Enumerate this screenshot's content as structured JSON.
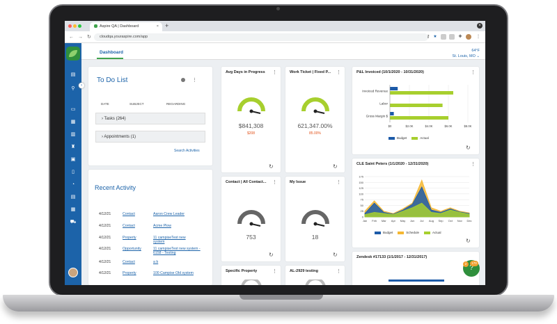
{
  "browser": {
    "tab_title": "Aspire QA | Dashboard",
    "url": "cloudqa.youraspire.com/app",
    "new_tab": "+",
    "close": "×"
  },
  "nav": {
    "dashboard_tab": "Dashboard",
    "weather_temp": "64°F",
    "weather_location": "St. Louis, MO"
  },
  "todo": {
    "title": "To Do List",
    "headers": [
      "DATE",
      "SUBJECT",
      "REGARDING"
    ],
    "tasks": "Tasks (264)",
    "appointments": "Appointments (1)",
    "search_link": "Search Activities"
  },
  "recent_activity": {
    "title": "Recent Activity",
    "rows": [
      {
        "date": "4/12/21",
        "type": "Contact",
        "name": "Aaron Crew Leader"
      },
      {
        "date": "4/12/21",
        "type": "Contact",
        "name": "Acme Plow"
      },
      {
        "date": "4/12/21",
        "type": "Property",
        "name": "11 campiseTest new system"
      },
      {
        "date": "4/12/21",
        "type": "Opportunity",
        "name": "11 campiseTest new system - 6158 - Testing"
      },
      {
        "date": "4/12/21",
        "type": "Contact",
        "name": "a b"
      },
      {
        "date": "4/12/21",
        "type": "Property",
        "name": "100 Campise Old system"
      }
    ]
  },
  "widgets": {
    "avg_days": {
      "title": "Avg Days in Progress",
      "value": "$841,308",
      "sub": "$208",
      "gauge": 0.85
    },
    "work_ticket": {
      "title": "Work Ticket | Fixed P...",
      "value": "621,347.00%",
      "sub": "85.00%",
      "gauge": 0.75
    },
    "contact": {
      "title": "Contact | All Contact...",
      "value": "753",
      "gauge": 0.1
    },
    "my_issue": {
      "title": "My Issue",
      "value": "18",
      "gauge": 0.1
    },
    "specific_property": {
      "title": "Specific Property"
    },
    "al_testing": {
      "title": "AL-2929 testing"
    }
  },
  "pl_invoiced": {
    "title": "P&L Invoiced (10/1/2020 - 10/31/2020)",
    "legend": [
      "Budget",
      "Actual"
    ]
  },
  "cle_saint_peters": {
    "title": "CLE Saint Peters (1/1/2020 - 12/31/2020)",
    "legend": [
      "Budget",
      "Schedule",
      "Actual"
    ]
  },
  "zendesk": {
    "title": "Zendesk #17133 (1/1/2017 - 12/31/2017)"
  },
  "help": {
    "badge_a": "2",
    "badge_b": "170"
  },
  "colors": {
    "brand_blue": "#1c63a9",
    "brand_green": "#3fa34d",
    "budget": "#1c5aa8",
    "actual": "#a7cf2e",
    "schedule": "#f5b731",
    "negative": "#e2521a"
  },
  "chart_data": [
    {
      "type": "bar",
      "title": "P&L Invoiced (10/1/2020 - 10/31/2020)",
      "categories": [
        "Invoiced Revenue",
        "Labor",
        "Gross Margin $"
      ],
      "series": [
        {
          "name": "Budget",
          "values": [
            800,
            0,
            400
          ]
        },
        {
          "name": "Actual",
          "values": [
            6500,
            5400,
            6000
          ]
        }
      ],
      "xlabel": "",
      "ylabel": "",
      "ticks": [
        "$0",
        "$2.0K",
        "$4.0K",
        "$6.0K",
        "$8.0K"
      ],
      "xlim": [
        0,
        8000
      ]
    },
    {
      "type": "area",
      "title": "CLE Saint Peters (1/1/2020 - 12/31/2020)",
      "categories": [
        "Jan",
        "Feb",
        "Mar",
        "Apr",
        "May",
        "Jun",
        "Jul",
        "Aug",
        "Sep",
        "Oct",
        "Nov",
        "Dec"
      ],
      "series": [
        {
          "name": "Budget",
          "values": [
            15,
            60,
            20,
            12,
            30,
            55,
            130,
            30,
            20,
            35,
            22,
            15
          ]
        },
        {
          "name": "Schedule",
          "values": [
            25,
            70,
            25,
            15,
            35,
            60,
            160,
            40,
            25,
            40,
            25,
            18
          ]
        },
        {
          "name": "Actual",
          "values": [
            10,
            20,
            15,
            10,
            25,
            40,
            60,
            20,
            15,
            30,
            20,
            12
          ]
        }
      ],
      "ticks": [
        "0",
        "25",
        "50",
        "75",
        "100",
        "125",
        "150",
        "175"
      ],
      "ylim": [
        0,
        175
      ]
    }
  ]
}
